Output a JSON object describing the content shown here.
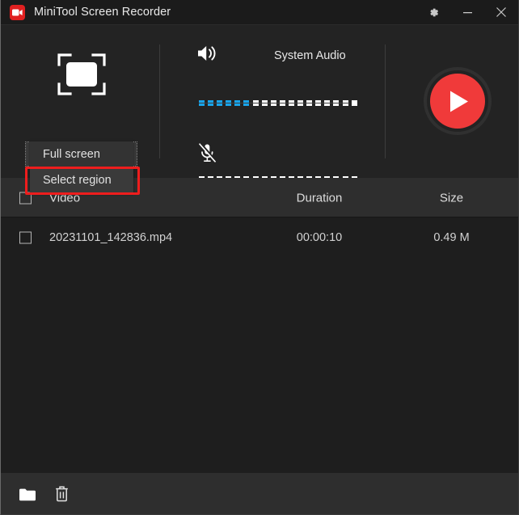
{
  "window": {
    "title": "MiniTool Screen Recorder",
    "app_icon": "video-camera-icon",
    "controls": {
      "settings_label": "gear-icon",
      "minimize_label": "minimize-icon",
      "close_label": "close-icon"
    }
  },
  "capture": {
    "icon": "capture-frame-icon",
    "selected_mode": "Full screen",
    "options": [
      "Full screen",
      "Select region"
    ],
    "chevron": "chevron-down-icon"
  },
  "annotation": {
    "color": "#ee1d1d",
    "target": "Select region"
  },
  "audio": {
    "system": {
      "label": "System Audio",
      "icon": "speaker-on-icon",
      "segments_total": 18,
      "segments_on": 6,
      "on_color": "#18a5ec",
      "off_color": "#ffffff"
    },
    "microphone": {
      "label": "",
      "icon": "microphone-muted-icon",
      "segments_total": 18,
      "segments_on": 0,
      "on_color": "#18a5ec",
      "off_color": "#ffffff"
    }
  },
  "record": {
    "icon": "play-triangle-icon",
    "color": "#f03a3a"
  },
  "table": {
    "columns": [
      "Video",
      "Duration",
      "Size"
    ],
    "rows": [
      {
        "video": "20231101_142836.mp4",
        "duration": "00:00:10",
        "size": "0.49 M"
      }
    ]
  },
  "bottom_bar": {
    "open_folder": "folder-icon",
    "delete": "trash-icon"
  }
}
